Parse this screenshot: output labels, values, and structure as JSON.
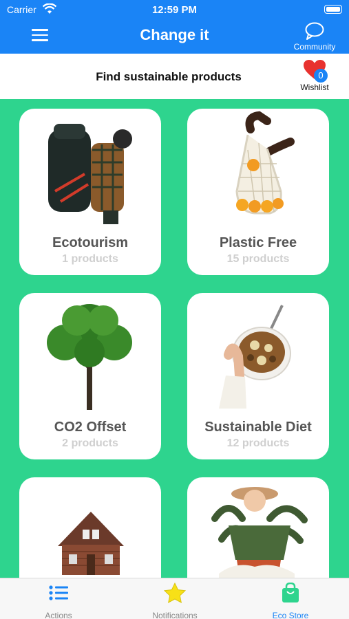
{
  "status": {
    "carrier": "Carrier",
    "time": "12:59 PM"
  },
  "header": {
    "title": "Change it",
    "community_label": "Community"
  },
  "subheader": {
    "title": "Find sustainable products",
    "wishlist_label": "Wishlist",
    "wishlist_count": "0"
  },
  "categories": [
    {
      "name": "Ecotourism",
      "count": "1 products",
      "image": "backpacker-image"
    },
    {
      "name": "Plastic Free",
      "count": "15 products",
      "image": "mesh-bag-image"
    },
    {
      "name": "CO2 Offset",
      "count": "2 products",
      "image": "tree-image"
    },
    {
      "name": "Sustainable Diet",
      "count": "12 products",
      "image": "granola-bowl-image"
    },
    {
      "name": "",
      "count": "",
      "image": "cabin-image"
    },
    {
      "name": "",
      "count": "",
      "image": "woman-with-plant-image"
    }
  ],
  "tabs": [
    {
      "label": "Actions",
      "icon": "list-icon"
    },
    {
      "label": "Notifications",
      "icon": "star-icon"
    },
    {
      "label": "Eco Store",
      "icon": "shopping-bag-icon",
      "active": true
    }
  ],
  "colors": {
    "brand_blue": "#1A84F6",
    "background_green": "#2ED48E",
    "heart_red": "#E8322F",
    "star_yellow": "#F7E017",
    "bag_green": "#2ED48E"
  }
}
